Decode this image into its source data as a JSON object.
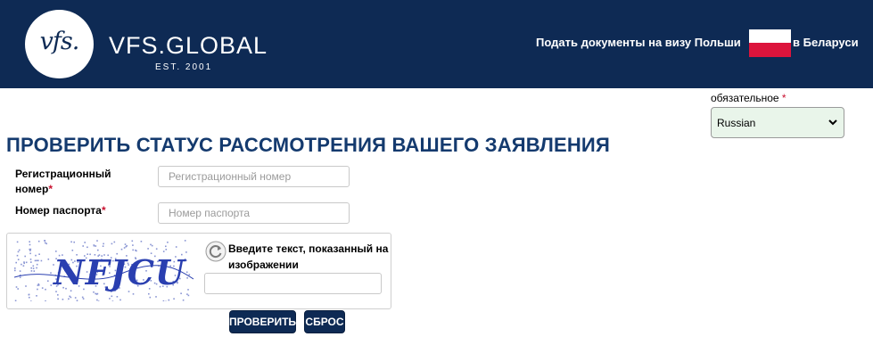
{
  "header": {
    "logo_mark": "vfs.",
    "brand": "VFS.GLOBAL",
    "est": "EST. 2001",
    "tagline_left": "Подать документы на визу Польши",
    "tagline_right": "в Беларуси",
    "background_color": "#0e2a54"
  },
  "language": {
    "label": "обязательное",
    "required_mark": "*",
    "selected": "Russian",
    "select_bg": "#e9f5ea"
  },
  "page": {
    "title": "ПРОВЕРИТЬ СТАТУС РАССМОТРЕНИЯ ВАШЕГО ЗАЯВЛЕНИЯ",
    "title_color": "#143a6e"
  },
  "form": {
    "reg_label_line1": "Регистрационный",
    "reg_label_line2": "номер",
    "reg_placeholder": "Регистрационный номер",
    "passport_label": "Номер паспорта",
    "passport_placeholder": "Номер паспорта",
    "required_mark": "*"
  },
  "captcha": {
    "image_text": "NFJCU",
    "instruction": "Введите текст, показанный на изображении",
    "refresh_icon": "refresh-icon"
  },
  "buttons": {
    "check": "ПРОВЕРИТЬ",
    "reset": "СБРОС",
    "color": "#0e2a54"
  }
}
